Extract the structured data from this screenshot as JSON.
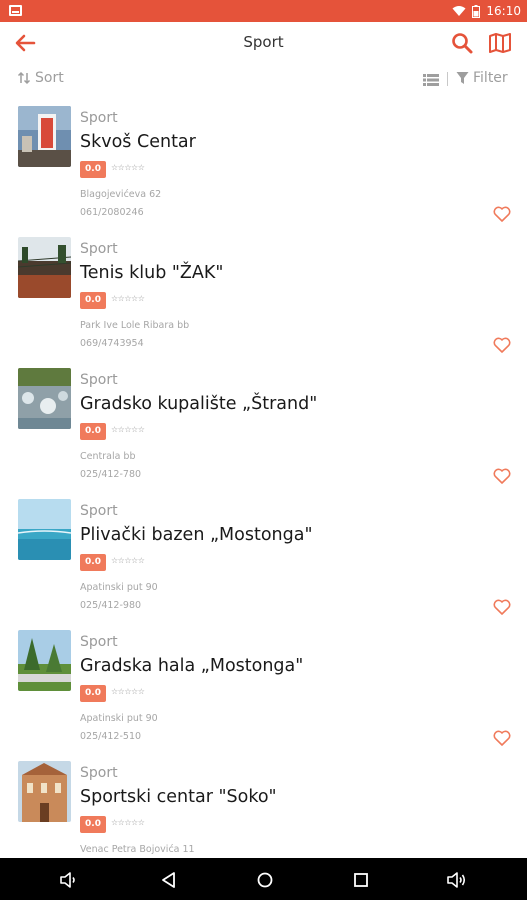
{
  "status_bar": {
    "time": "16:10",
    "icons": [
      "notification-icon",
      "wifi-icon",
      "battery-icon"
    ]
  },
  "app_bar": {
    "title": "Sport",
    "icons": [
      "back-arrow-icon",
      "search-icon",
      "map-icon"
    ]
  },
  "toolbar": {
    "sort_label": "Sort",
    "filter_label": "Filter"
  },
  "colors": {
    "accent": "#e5533a",
    "rating_badge": "#f07a5b"
  },
  "items": [
    {
      "category": "Sport",
      "name": "Skvoš Centar",
      "rating": "0.0",
      "stars": "☆☆☆☆☆",
      "address": "Blagojevićeva 62",
      "phone": "061/2080246"
    },
    {
      "category": "Sport",
      "name": "Tenis klub \"ŽAK\"",
      "rating": "0.0",
      "stars": "☆☆☆☆☆",
      "address": "Park Ive Lole Ribara bb",
      "phone": "069/4743954"
    },
    {
      "category": "Sport",
      "name": "Gradsko kupalište „Štrand\"",
      "rating": "0.0",
      "stars": "☆☆☆☆☆",
      "address": "Centrala bb",
      "phone": "025/412-780"
    },
    {
      "category": "Sport",
      "name": "Plivački bazen „Mostonga\"",
      "rating": "0.0",
      "stars": "☆☆☆☆☆",
      "address": "Apatinski put 90",
      "phone": "025/412-980"
    },
    {
      "category": "Sport",
      "name": "Gradska hala „Mostonga\"",
      "rating": "0.0",
      "stars": "☆☆☆☆☆",
      "address": "Apatinski put 90",
      "phone": "025/412-510"
    },
    {
      "category": "Sport",
      "name": "Sportski centar \"Soko\"",
      "rating": "0.0",
      "stars": "☆☆☆☆☆",
      "address": "Venac Petra Bojovića 11",
      "phone": ""
    }
  ]
}
